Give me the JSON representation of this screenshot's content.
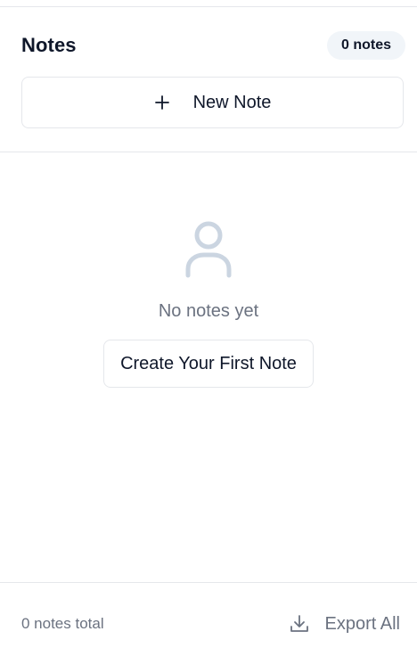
{
  "header": {
    "title": "Notes",
    "count_badge": "0 notes"
  },
  "actions": {
    "new_note_label": "New Note",
    "new_note_icon": "plus-icon"
  },
  "empty_state": {
    "icon": "user-icon",
    "message": "No notes yet",
    "cta_label": "Create Your First Note"
  },
  "footer": {
    "total_text": "0 notes total",
    "export_label": "Export All",
    "export_icon": "download-icon"
  },
  "colors": {
    "text_primary": "#0f172a",
    "text_muted": "#6b7280",
    "border": "#e5e7eb",
    "badge_bg": "#f1f5f9",
    "icon_muted": "#cbd5e1"
  }
}
